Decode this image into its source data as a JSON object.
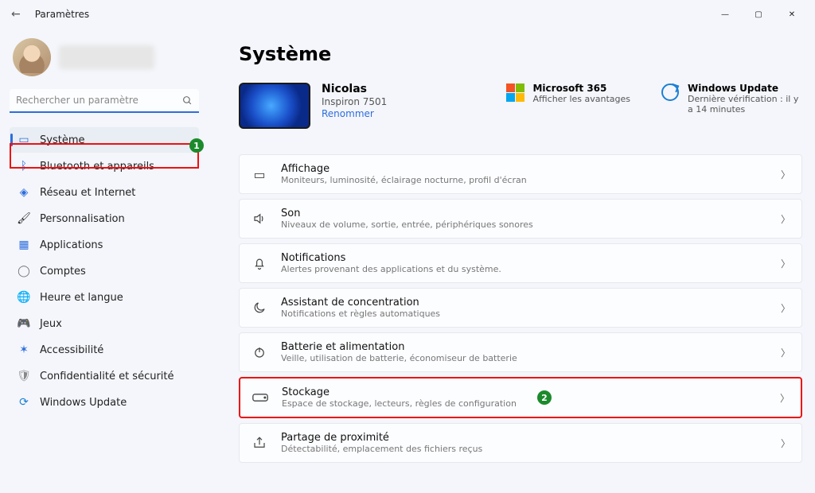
{
  "window": {
    "title": "Paramètres"
  },
  "search": {
    "placeholder": "Rechercher un paramètre"
  },
  "sidebar": {
    "items": [
      {
        "label": "Système"
      },
      {
        "label": "Bluetooth et appareils"
      },
      {
        "label": "Réseau et Internet"
      },
      {
        "label": "Personnalisation"
      },
      {
        "label": "Applications"
      },
      {
        "label": "Comptes"
      },
      {
        "label": "Heure et langue"
      },
      {
        "label": "Jeux"
      },
      {
        "label": "Accessibilité"
      },
      {
        "label": "Confidentialité et sécurité"
      },
      {
        "label": "Windows Update"
      }
    ]
  },
  "main": {
    "heading": "Système",
    "device": {
      "name": "Nicolas",
      "model": "Inspiron 7501",
      "rename": "Renommer"
    },
    "pills": {
      "ms365": {
        "title": "Microsoft 365",
        "sub": "Afficher les avantages"
      },
      "wu": {
        "title": "Windows Update",
        "sub": "Dernière vérification : il y a 14 minutes"
      }
    },
    "cards": [
      {
        "title": "Affichage",
        "sub": "Moniteurs, luminosité, éclairage nocturne, profil d'écran"
      },
      {
        "title": "Son",
        "sub": "Niveaux de volume, sortie, entrée, périphériques sonores"
      },
      {
        "title": "Notifications",
        "sub": "Alertes provenant des applications et du système."
      },
      {
        "title": "Assistant de concentration",
        "sub": "Notifications et règles automatiques"
      },
      {
        "title": "Batterie et alimentation",
        "sub": "Veille, utilisation de batterie, économiseur de batterie"
      },
      {
        "title": "Stockage",
        "sub": "Espace de stockage, lecteurs, règles de configuration"
      },
      {
        "title": "Partage de proximité",
        "sub": "Détectabilité, emplacement des fichiers reçus"
      }
    ]
  },
  "annotations": {
    "b1": "1",
    "b2": "2"
  }
}
